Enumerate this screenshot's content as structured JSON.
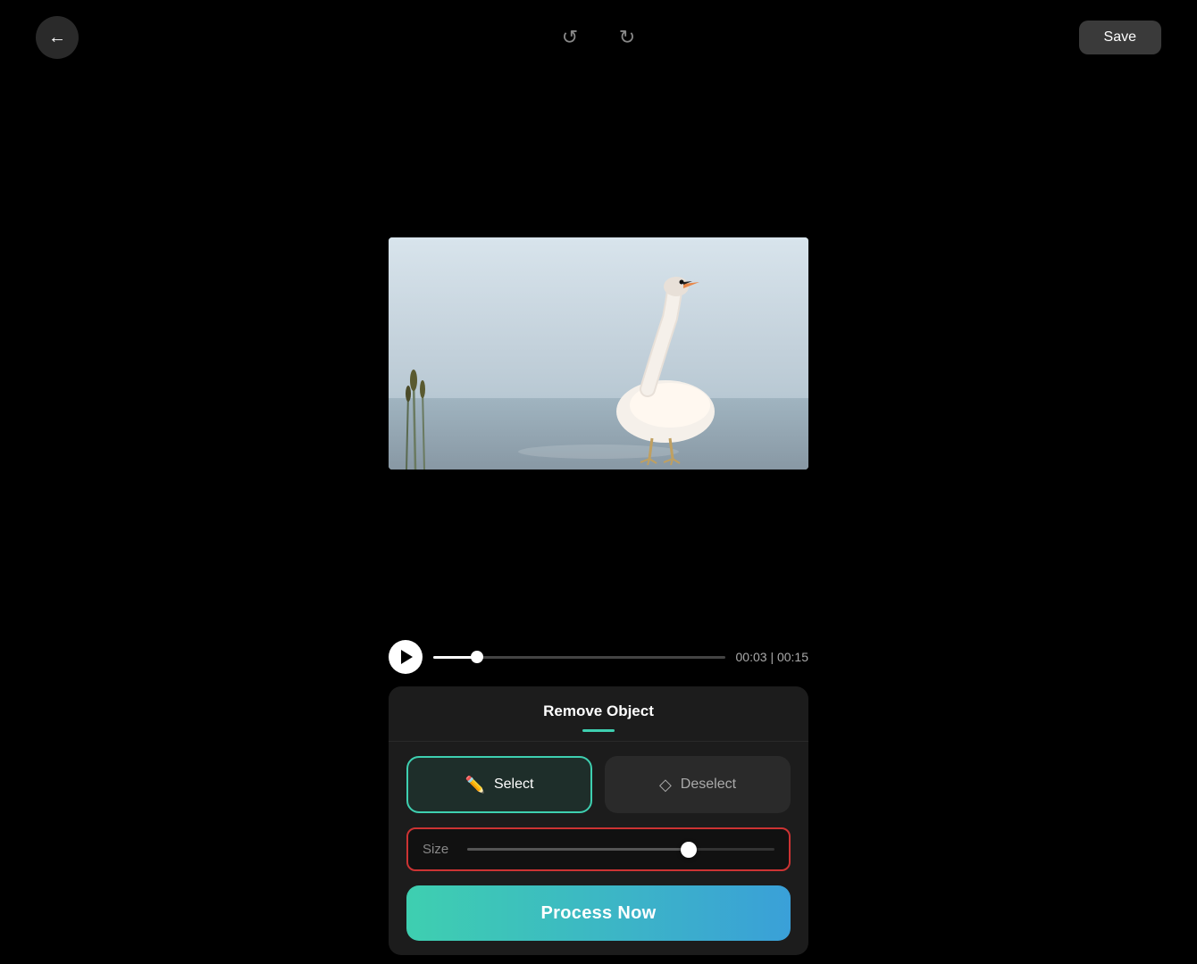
{
  "toolbar": {
    "back_icon": "←",
    "undo_icon": "↺",
    "redo_icon": "↻",
    "save_label": "Save"
  },
  "timeline": {
    "time_current": "00:03",
    "time_total": "00:15",
    "time_display": "00:03 | 00:15",
    "progress_percent": 15
  },
  "panel": {
    "title": "Remove Object",
    "select_label": "Select",
    "deselect_label": "Deselect",
    "size_label": "Size",
    "process_label": "Process Now"
  }
}
